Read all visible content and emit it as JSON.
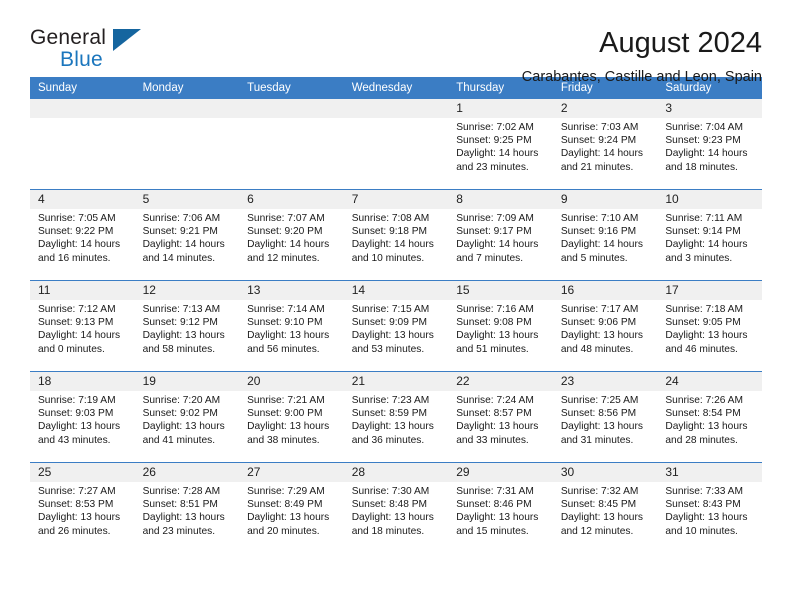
{
  "brand": {
    "name_part1": "General",
    "name_part2": "Blue",
    "logo_icon": "triangle-logo-icon",
    "blue": "#1b76bd"
  },
  "header": {
    "month_title": "August 2024",
    "location": "Carabantes, Castille and Leon, Spain"
  },
  "calendar": {
    "accent_color": "#3b7dc4",
    "daynum_band_color": "#f0f0f0",
    "weekday_headers": [
      "Sunday",
      "Monday",
      "Tuesday",
      "Wednesday",
      "Thursday",
      "Friday",
      "Saturday"
    ],
    "weeks": [
      [
        {
          "day": "",
          "empty": true
        },
        {
          "day": "",
          "empty": true
        },
        {
          "day": "",
          "empty": true
        },
        {
          "day": "",
          "empty": true
        },
        {
          "day": "1",
          "sunrise": "Sunrise: 7:02 AM",
          "sunset": "Sunset: 9:25 PM",
          "daylight": "Daylight: 14 hours and 23 minutes."
        },
        {
          "day": "2",
          "sunrise": "Sunrise: 7:03 AM",
          "sunset": "Sunset: 9:24 PM",
          "daylight": "Daylight: 14 hours and 21 minutes."
        },
        {
          "day": "3",
          "sunrise": "Sunrise: 7:04 AM",
          "sunset": "Sunset: 9:23 PM",
          "daylight": "Daylight: 14 hours and 18 minutes."
        }
      ],
      [
        {
          "day": "4",
          "sunrise": "Sunrise: 7:05 AM",
          "sunset": "Sunset: 9:22 PM",
          "daylight": "Daylight: 14 hours and 16 minutes."
        },
        {
          "day": "5",
          "sunrise": "Sunrise: 7:06 AM",
          "sunset": "Sunset: 9:21 PM",
          "daylight": "Daylight: 14 hours and 14 minutes."
        },
        {
          "day": "6",
          "sunrise": "Sunrise: 7:07 AM",
          "sunset": "Sunset: 9:20 PM",
          "daylight": "Daylight: 14 hours and 12 minutes."
        },
        {
          "day": "7",
          "sunrise": "Sunrise: 7:08 AM",
          "sunset": "Sunset: 9:18 PM",
          "daylight": "Daylight: 14 hours and 10 minutes."
        },
        {
          "day": "8",
          "sunrise": "Sunrise: 7:09 AM",
          "sunset": "Sunset: 9:17 PM",
          "daylight": "Daylight: 14 hours and 7 minutes."
        },
        {
          "day": "9",
          "sunrise": "Sunrise: 7:10 AM",
          "sunset": "Sunset: 9:16 PM",
          "daylight": "Daylight: 14 hours and 5 minutes."
        },
        {
          "day": "10",
          "sunrise": "Sunrise: 7:11 AM",
          "sunset": "Sunset: 9:14 PM",
          "daylight": "Daylight: 14 hours and 3 minutes."
        }
      ],
      [
        {
          "day": "11",
          "sunrise": "Sunrise: 7:12 AM",
          "sunset": "Sunset: 9:13 PM",
          "daylight": "Daylight: 14 hours and 0 minutes."
        },
        {
          "day": "12",
          "sunrise": "Sunrise: 7:13 AM",
          "sunset": "Sunset: 9:12 PM",
          "daylight": "Daylight: 13 hours and 58 minutes."
        },
        {
          "day": "13",
          "sunrise": "Sunrise: 7:14 AM",
          "sunset": "Sunset: 9:10 PM",
          "daylight": "Daylight: 13 hours and 56 minutes."
        },
        {
          "day": "14",
          "sunrise": "Sunrise: 7:15 AM",
          "sunset": "Sunset: 9:09 PM",
          "daylight": "Daylight: 13 hours and 53 minutes."
        },
        {
          "day": "15",
          "sunrise": "Sunrise: 7:16 AM",
          "sunset": "Sunset: 9:08 PM",
          "daylight": "Daylight: 13 hours and 51 minutes."
        },
        {
          "day": "16",
          "sunrise": "Sunrise: 7:17 AM",
          "sunset": "Sunset: 9:06 PM",
          "daylight": "Daylight: 13 hours and 48 minutes."
        },
        {
          "day": "17",
          "sunrise": "Sunrise: 7:18 AM",
          "sunset": "Sunset: 9:05 PM",
          "daylight": "Daylight: 13 hours and 46 minutes."
        }
      ],
      [
        {
          "day": "18",
          "sunrise": "Sunrise: 7:19 AM",
          "sunset": "Sunset: 9:03 PM",
          "daylight": "Daylight: 13 hours and 43 minutes."
        },
        {
          "day": "19",
          "sunrise": "Sunrise: 7:20 AM",
          "sunset": "Sunset: 9:02 PM",
          "daylight": "Daylight: 13 hours and 41 minutes."
        },
        {
          "day": "20",
          "sunrise": "Sunrise: 7:21 AM",
          "sunset": "Sunset: 9:00 PM",
          "daylight": "Daylight: 13 hours and 38 minutes."
        },
        {
          "day": "21",
          "sunrise": "Sunrise: 7:23 AM",
          "sunset": "Sunset: 8:59 PM",
          "daylight": "Daylight: 13 hours and 36 minutes."
        },
        {
          "day": "22",
          "sunrise": "Sunrise: 7:24 AM",
          "sunset": "Sunset: 8:57 PM",
          "daylight": "Daylight: 13 hours and 33 minutes."
        },
        {
          "day": "23",
          "sunrise": "Sunrise: 7:25 AM",
          "sunset": "Sunset: 8:56 PM",
          "daylight": "Daylight: 13 hours and 31 minutes."
        },
        {
          "day": "24",
          "sunrise": "Sunrise: 7:26 AM",
          "sunset": "Sunset: 8:54 PM",
          "daylight": "Daylight: 13 hours and 28 minutes."
        }
      ],
      [
        {
          "day": "25",
          "sunrise": "Sunrise: 7:27 AM",
          "sunset": "Sunset: 8:53 PM",
          "daylight": "Daylight: 13 hours and 26 minutes."
        },
        {
          "day": "26",
          "sunrise": "Sunrise: 7:28 AM",
          "sunset": "Sunset: 8:51 PM",
          "daylight": "Daylight: 13 hours and 23 minutes."
        },
        {
          "day": "27",
          "sunrise": "Sunrise: 7:29 AM",
          "sunset": "Sunset: 8:49 PM",
          "daylight": "Daylight: 13 hours and 20 minutes."
        },
        {
          "day": "28",
          "sunrise": "Sunrise: 7:30 AM",
          "sunset": "Sunset: 8:48 PM",
          "daylight": "Daylight: 13 hours and 18 minutes."
        },
        {
          "day": "29",
          "sunrise": "Sunrise: 7:31 AM",
          "sunset": "Sunset: 8:46 PM",
          "daylight": "Daylight: 13 hours and 15 minutes."
        },
        {
          "day": "30",
          "sunrise": "Sunrise: 7:32 AM",
          "sunset": "Sunset: 8:45 PM",
          "daylight": "Daylight: 13 hours and 12 minutes."
        },
        {
          "day": "31",
          "sunrise": "Sunrise: 7:33 AM",
          "sunset": "Sunset: 8:43 PM",
          "daylight": "Daylight: 13 hours and 10 minutes."
        }
      ]
    ]
  }
}
